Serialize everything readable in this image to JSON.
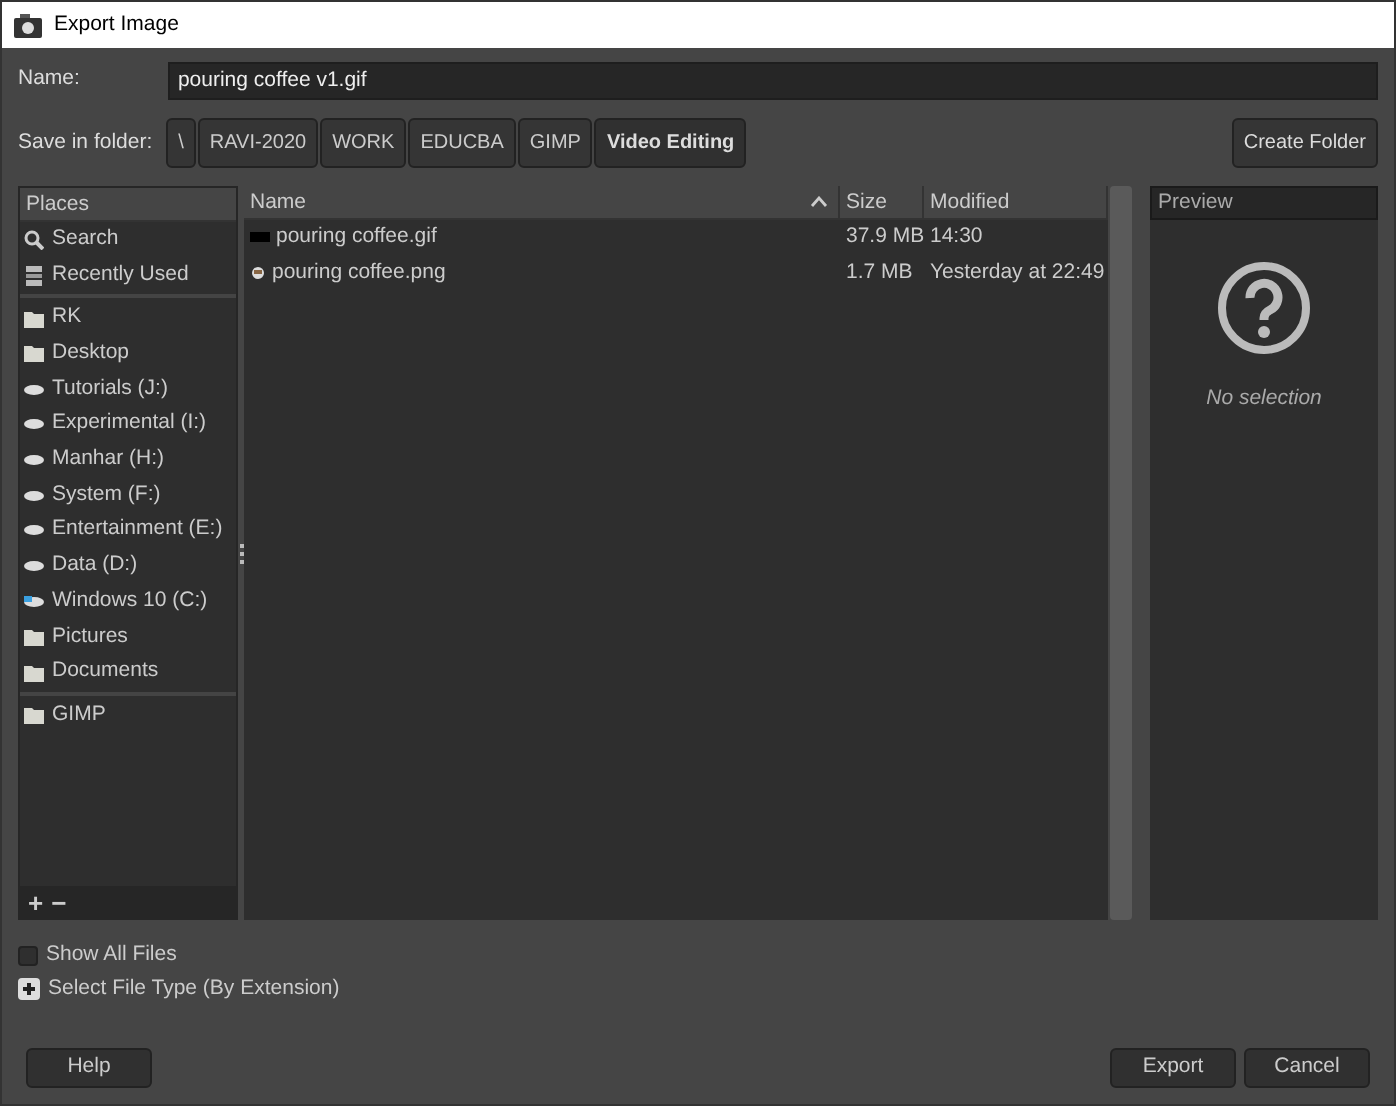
{
  "window": {
    "title": "Export Image"
  },
  "name_field": {
    "label": "Name:",
    "value": "pouring coffee v1.gif"
  },
  "save_in": {
    "label": "Save in folder:",
    "path": [
      {
        "label": "\\",
        "selected": false
      },
      {
        "label": "RAVI-2020",
        "selected": false
      },
      {
        "label": "WORK",
        "selected": false
      },
      {
        "label": "EDUCBA",
        "selected": false
      },
      {
        "label": "GIMP",
        "selected": false
      },
      {
        "label": "Video Editing",
        "selected": true
      }
    ]
  },
  "create_folder_button": "Create Folder",
  "places": {
    "title": "Places",
    "groups": [
      [
        {
          "label": "Search",
          "kind": "search"
        },
        {
          "label": "Recently Used",
          "kind": "recent"
        }
      ],
      [
        {
          "label": "RK",
          "kind": "folder"
        },
        {
          "label": "Desktop",
          "kind": "folder"
        },
        {
          "label": "Tutorials (J:)",
          "kind": "drive"
        },
        {
          "label": "Experimental (I:)",
          "kind": "drive"
        },
        {
          "label": "Manhar (H:)",
          "kind": "drive"
        },
        {
          "label": "System (F:)",
          "kind": "drive"
        },
        {
          "label": "Entertainment (E:)",
          "kind": "drive"
        },
        {
          "label": "Data (D:)",
          "kind": "drive"
        },
        {
          "label": "Windows 10 (C:)",
          "kind": "system-drive"
        },
        {
          "label": "Pictures",
          "kind": "folder"
        },
        {
          "label": "Documents",
          "kind": "folder"
        }
      ],
      [
        {
          "label": "GIMP",
          "kind": "folder"
        }
      ]
    ],
    "add_button": "+",
    "remove_button": "−"
  },
  "files": {
    "columns": [
      {
        "label": "Name",
        "sorted": true
      },
      {
        "label": "Size",
        "sorted": false
      },
      {
        "label": "Modified",
        "sorted": false
      }
    ],
    "rows": [
      {
        "name": "pouring coffee.gif",
        "kind": "gif",
        "size": "37.9 MB",
        "modified": "14:30"
      },
      {
        "name": "pouring coffee.png",
        "kind": "png",
        "size": "1.7 MB",
        "modified": "Yesterday at 22:49"
      }
    ]
  },
  "preview": {
    "title": "Preview",
    "message": "No selection"
  },
  "show_all_files": {
    "label": "Show All Files",
    "checked": false
  },
  "file_type": {
    "label": "Select File Type (By Extension)",
    "expanded": false
  },
  "buttons": {
    "help": "Help",
    "export": "Export",
    "cancel": "Cancel"
  }
}
